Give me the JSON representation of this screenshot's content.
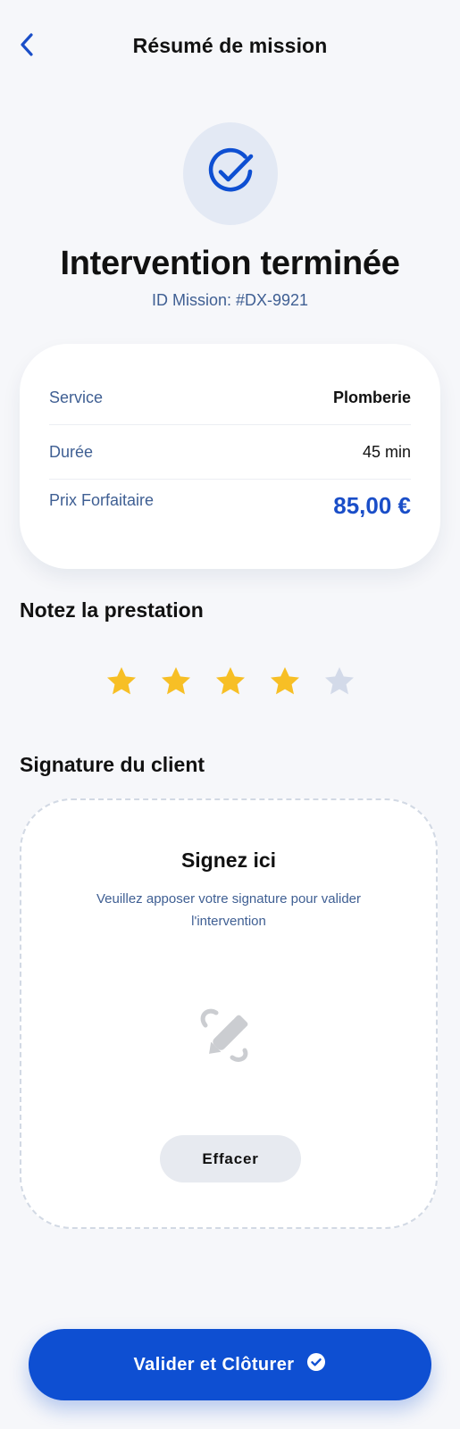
{
  "header": {
    "title": "Résumé de mission",
    "back_icon": "chevron-left-icon"
  },
  "status": {
    "icon": "check-circle-icon",
    "title": "Intervention terminée",
    "mission_id": "ID Mission: #DX-9921"
  },
  "summary": {
    "rows": [
      {
        "label": "Service",
        "value": "Plomberie"
      },
      {
        "label": "Durée",
        "value": "45 min"
      },
      {
        "label": "Prix Forfaitaire",
        "value": "85,00 €"
      }
    ]
  },
  "rating": {
    "title": "Notez la prestation",
    "value": 4,
    "max": 5
  },
  "signature": {
    "section_title": "Signature du client",
    "box_title": "Signez ici",
    "description": "Veuillez apposer votre signature pour valider l'intervention",
    "icon": "signature-pencil-icon",
    "clear_label": "Effacer"
  },
  "footer": {
    "submit_label": "Valider et Clôturer",
    "submit_icon": "check-circle-icon"
  },
  "colors": {
    "accent": "#0e4fd2",
    "price": "#1a4ec8",
    "star_active": "#f7bf25",
    "star_inactive": "#d3dae9",
    "muted_text": "#3f5f93"
  }
}
